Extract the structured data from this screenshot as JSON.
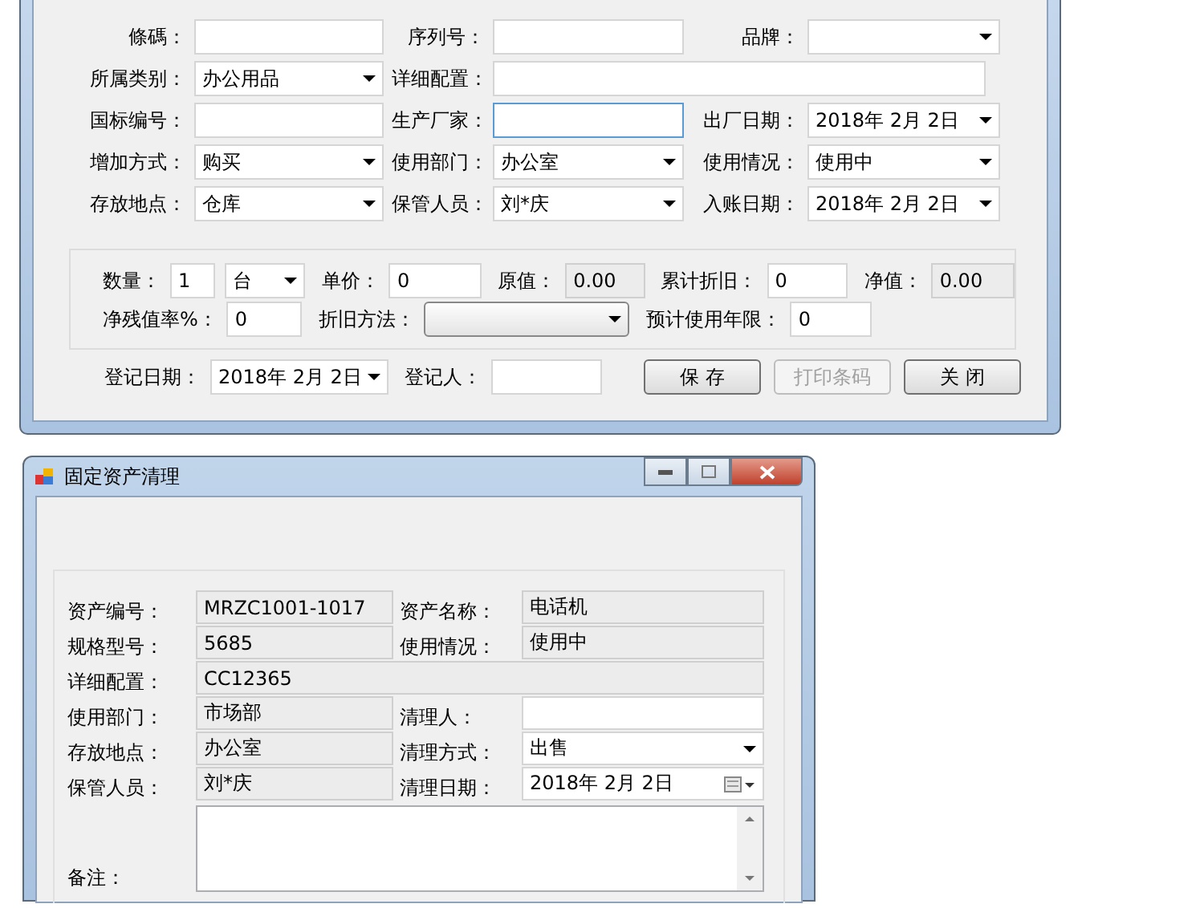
{
  "top_window": {
    "rows": [
      {
        "fields": [
          {
            "label": "條碼：",
            "kind": "text"
          },
          {
            "label": "序列号：",
            "kind": "text"
          },
          {
            "label": "品牌：",
            "kind": "combo"
          }
        ]
      },
      {
        "fields": [
          {
            "label": "所属类别：",
            "kind": "combo",
            "value": "办公用品"
          },
          {
            "label": "详细配置：",
            "kind": "wide"
          }
        ]
      },
      {
        "fields": [
          {
            "label": "国标编号：",
            "kind": "text"
          },
          {
            "label": "生产厂家：",
            "kind": "text",
            "focused": true
          },
          {
            "label": "出厂日期：",
            "kind": "date",
            "value": "2018年 2月 2日"
          }
        ]
      },
      {
        "fields": [
          {
            "label": "增加方式：",
            "kind": "combo",
            "value": "购买"
          },
          {
            "label": "使用部门：",
            "kind": "combo",
            "value": "办公室"
          },
          {
            "label": "使用情况：",
            "kind": "combo",
            "value": "使用中"
          }
        ]
      },
      {
        "fields": [
          {
            "label": "存放地点：",
            "kind": "combo",
            "value": "仓库"
          },
          {
            "label": "保管人员：",
            "kind": "combo",
            "value": "刘*庆"
          },
          {
            "label": "入账日期：",
            "kind": "date",
            "value": "2018年 2月 2日"
          }
        ]
      }
    ],
    "group": {
      "rows": [
        {
          "items": [
            {
              "label": "数量：",
              "kind": "text",
              "value": "1"
            },
            {
              "kind": "combo",
              "value": "台"
            },
            {
              "label": "单价：",
              "kind": "text",
              "value": "0"
            },
            {
              "label": "原值：",
              "kind": "readonly",
              "value": "0.00"
            },
            {
              "label": "累计折旧：",
              "kind": "text",
              "value": "0"
            },
            {
              "label": "净值：",
              "kind": "readonly",
              "value": "0.00"
            }
          ]
        },
        {
          "items": [
            {
              "label": "净残值率%：",
              "kind": "text",
              "value": "0"
            },
            {
              "label": "折旧方法：",
              "kind": "combo3d"
            },
            {
              "label": "预计使用年限：",
              "kind": "text",
              "value": "0"
            }
          ]
        }
      ]
    },
    "footer": {
      "fields": [
        {
          "label": "登记日期：",
          "kind": "date",
          "value": "2018年 2月 2日"
        },
        {
          "label": "登记人：",
          "kind": "text"
        }
      ],
      "buttons": [
        {
          "label": "保 存",
          "disabled": false
        },
        {
          "label": "打印条码",
          "disabled": true
        },
        {
          "label": "关 闭",
          "disabled": false
        }
      ]
    }
  },
  "bottom_window": {
    "title": "固定资产清理",
    "rows": [
      {
        "fields": [
          {
            "label": "资产编号：",
            "kind": "readonly",
            "value": "MRZC1001-1017"
          },
          {
            "label": "资产名称：",
            "kind": "readonly",
            "value": "电话机"
          }
        ]
      },
      {
        "fields": [
          {
            "label": "规格型号：",
            "kind": "readonly",
            "value": "5685"
          },
          {
            "label": "使用情况：",
            "kind": "readonly",
            "value": "使用中"
          }
        ]
      },
      {
        "fields": [
          {
            "label": "详细配置：",
            "kind": "readonly_wide",
            "value": "CC12365"
          }
        ]
      },
      {
        "fields": [
          {
            "label": "使用部门：",
            "kind": "readonly",
            "value": "市场部"
          },
          {
            "label": "清理人：",
            "kind": "text"
          }
        ]
      },
      {
        "fields": [
          {
            "label": "存放地点：",
            "kind": "readonly",
            "value": "办公室"
          },
          {
            "label": "清理方式：",
            "kind": "combo",
            "value": "出售"
          }
        ]
      },
      {
        "fields": [
          {
            "label": "保管人员：",
            "kind": "readonly",
            "value": "刘*庆"
          },
          {
            "label": "清理日期：",
            "kind": "calendar",
            "value": "2018年 2月 2日"
          }
        ]
      }
    ],
    "remarks": {
      "label": "备注："
    }
  }
}
